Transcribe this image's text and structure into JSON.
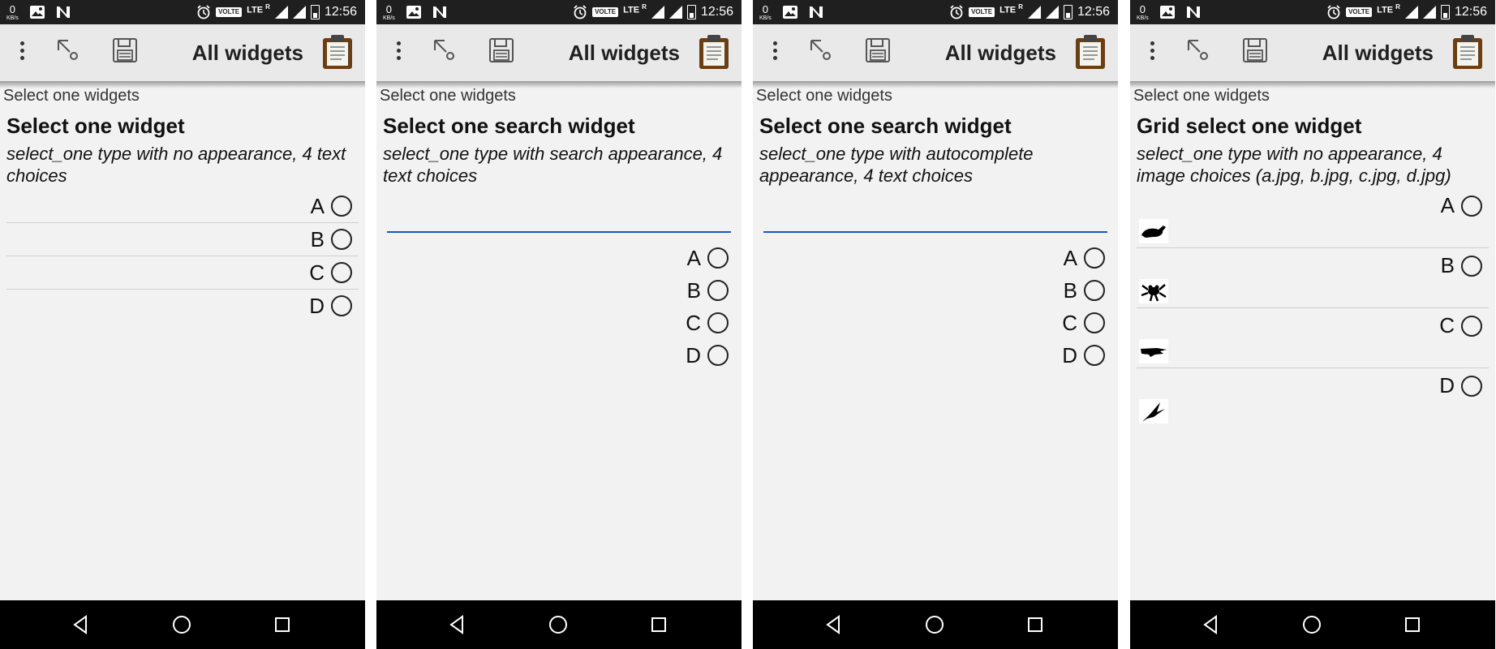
{
  "colors": {
    "status_bar": "#1f1f1f",
    "toolbar": "#e9e9e9",
    "page": "#f2f2f2",
    "search_underline": "#1a56c8",
    "nav_bar": "#000000"
  },
  "status_bar": {
    "net_speed": "0",
    "net_unit": "KB/s",
    "volte": "VOLTE",
    "lte": "LTE",
    "roaming": "R",
    "time": "12:56"
  },
  "toolbar": {
    "title": "All widgets"
  },
  "screens": [
    {
      "breadcrumb": "Select one widgets",
      "title": "Select one widget",
      "hint": "select_one type with no appearance, 4 text choices",
      "choices": [
        "A",
        "B",
        "C",
        "D"
      ]
    },
    {
      "breadcrumb": "Select one widgets",
      "title": "Select one search widget",
      "hint": "select_one type with search appearance, 4 text choices",
      "choices": [
        "A",
        "B",
        "C",
        "D"
      ]
    },
    {
      "breadcrumb": "Select one widgets",
      "title": "Select one search widget",
      "hint": "select_one type with autocomplete appearance, 4 text choices",
      "choices": [
        "A",
        "B",
        "C",
        "D"
      ]
    },
    {
      "breadcrumb": "Select one widgets",
      "title": "Grid select one widget",
      "hint": "select_one type with no appearance, 4 image choices (a.jpg, b.jpg, c.jpg, d.jpg)",
      "choices": [
        "A",
        "B",
        "C",
        "D"
      ],
      "choice_images": [
        "whale-icon",
        "frog-icon",
        "crocodile-icon",
        "bird-icon"
      ]
    }
  ]
}
